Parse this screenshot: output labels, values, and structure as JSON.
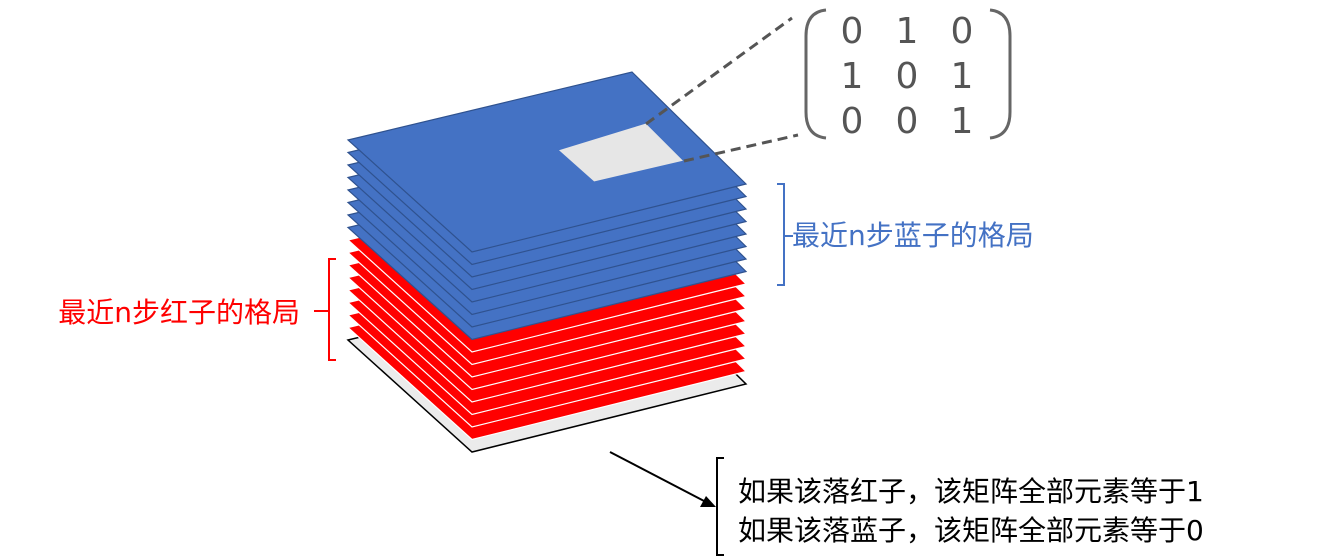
{
  "matrix": {
    "rows": [
      [
        "0",
        "1",
        "0"
      ],
      [
        "1",
        "0",
        "1"
      ],
      [
        "0",
        "0",
        "1"
      ]
    ]
  },
  "labels": {
    "blue_layers": "最近n步蓝子的格局",
    "red_layers": "最近n步红子的格局",
    "bottom_line1": "如果该落红子，该矩阵全部元素等于1",
    "bottom_line2": "如果该落蓝子，该矩阵全部元素等于0"
  },
  "colors": {
    "blue_layer": "#4472c4",
    "red_layer": "#ff0000",
    "gray_layer": "#ebebeb",
    "highlight": "#e6e6e6",
    "blue_text": "#4472c4",
    "red_text": "#ff0000",
    "matrix_text": "#555555"
  },
  "layer_counts": {
    "blue": 8,
    "red": 8,
    "gray": 1
  }
}
